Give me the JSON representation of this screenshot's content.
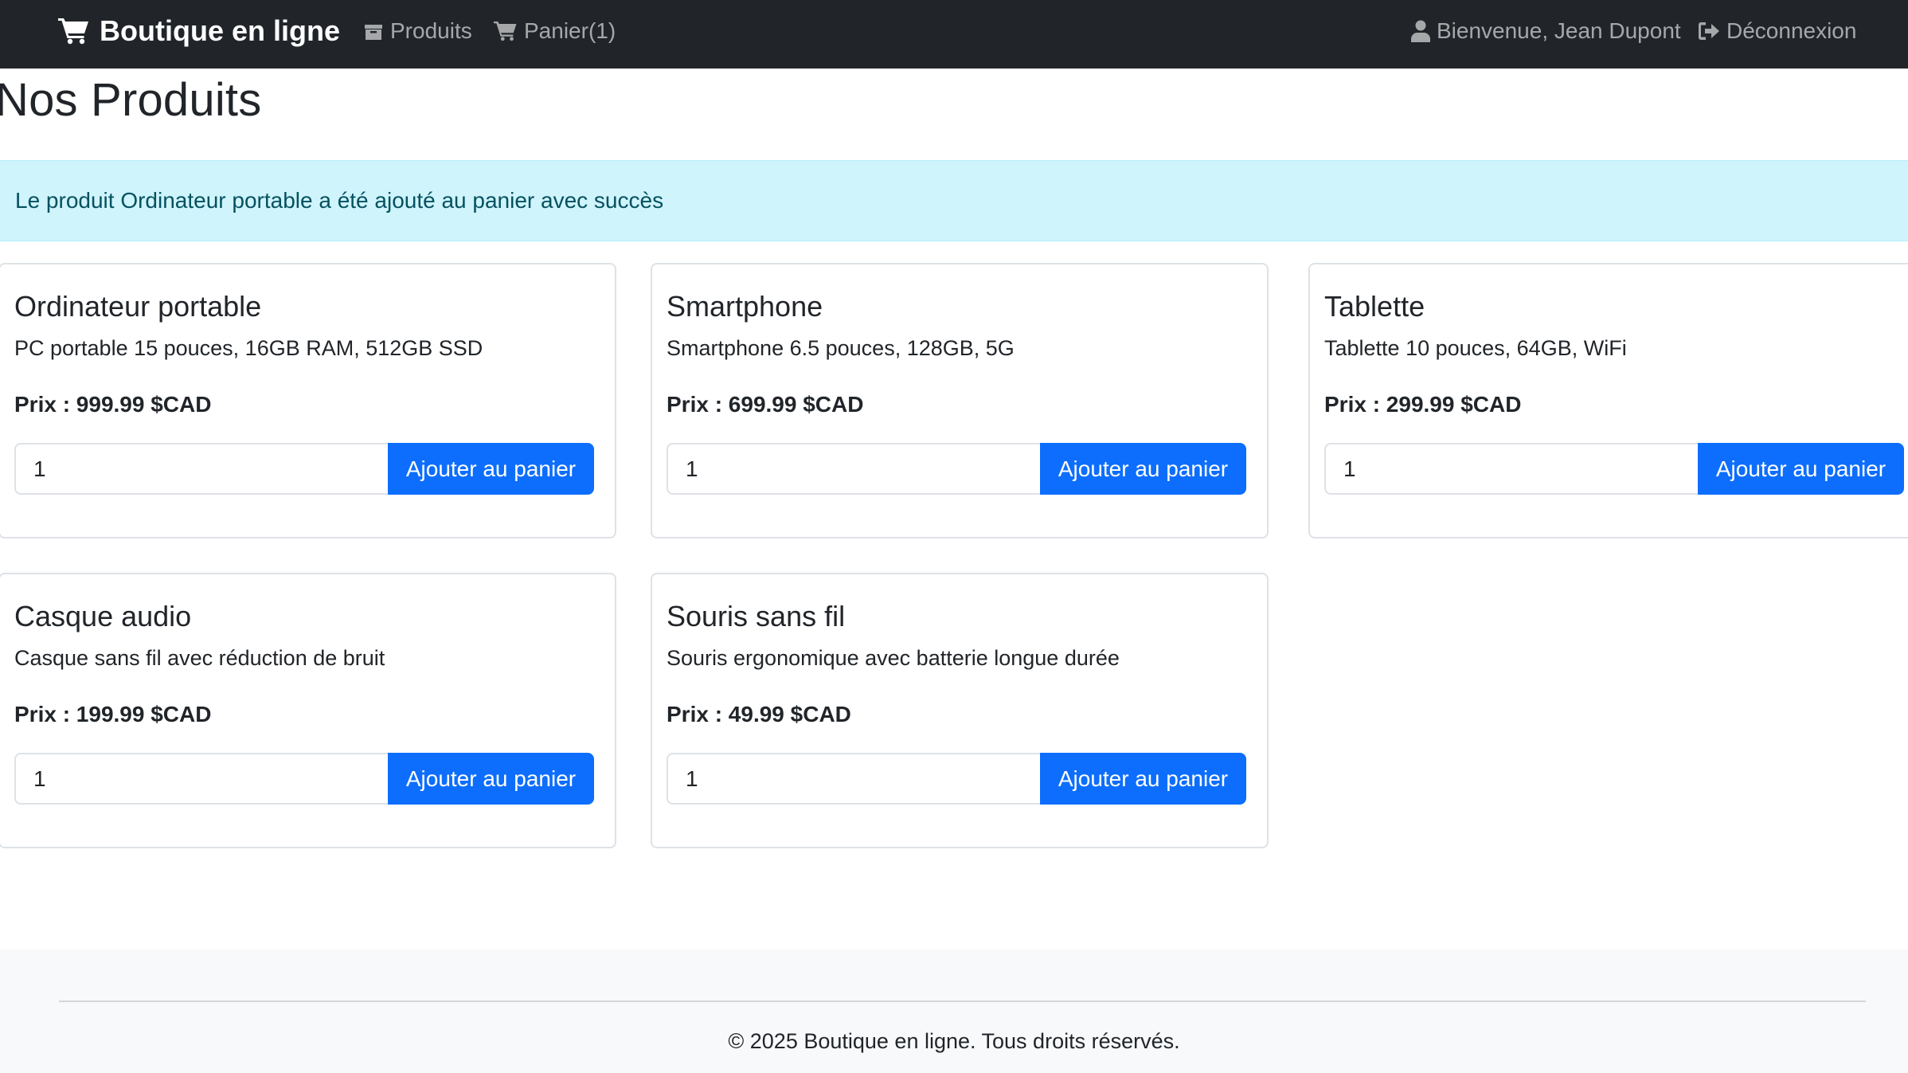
{
  "navbar": {
    "brand": "Boutique en ligne",
    "links": {
      "produits": "Produits",
      "panier": "Panier(1)",
      "user": "Bienvenue, Jean Dupont",
      "logout": "Déconnexion"
    },
    "icons": {
      "brand": "cart-icon",
      "produits": "box-icon",
      "panier": "cart-icon",
      "user": "user-icon",
      "logout": "sign-out-icon"
    }
  },
  "page": {
    "title": "Nos Produits",
    "alert": "Le produit Ordinateur portable a été ajouté au panier avec succès"
  },
  "products": [
    {
      "name": "Ordinateur portable",
      "description": "PC portable 15 pouces, 16GB RAM, 512GB SSD",
      "price": "Prix : 999.99 $CAD",
      "qty": "1",
      "button": "Ajouter au panier"
    },
    {
      "name": "Smartphone",
      "description": "Smartphone 6.5 pouces, 128GB, 5G",
      "price": "Prix : 699.99 $CAD",
      "qty": "1",
      "button": "Ajouter au panier"
    },
    {
      "name": "Tablette",
      "description": "Tablette 10 pouces, 64GB, WiFi",
      "price": "Prix : 299.99 $CAD",
      "qty": "1",
      "button": "Ajouter au panier"
    },
    {
      "name": "Casque audio",
      "description": "Casque sans fil avec réduction de bruit",
      "price": "Prix : 199.99 $CAD",
      "qty": "1",
      "button": "Ajouter au panier"
    },
    {
      "name": "Souris sans fil",
      "description": "Souris ergonomique avec batterie longue durée",
      "price": "Prix : 49.99 $CAD",
      "qty": "1",
      "button": "Ajouter au panier"
    }
  ],
  "footer": {
    "text": "© 2025 Boutique en ligne. Tous droits réservés."
  },
  "colors": {
    "navbar_bg": "#212529",
    "primary": "#0d6efd",
    "alert_bg": "#cff4fc",
    "alert_text": "#055160",
    "footer_bg": "#f8f9fa"
  }
}
